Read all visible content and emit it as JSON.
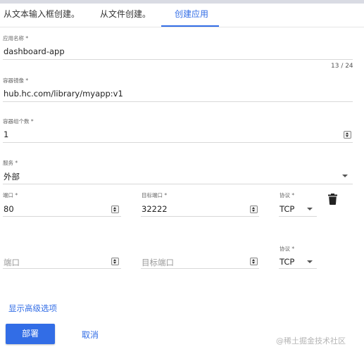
{
  "tabs": [
    {
      "label": "从文本输入框创建。"
    },
    {
      "label": "从文件创建。"
    },
    {
      "label": "创建应用"
    }
  ],
  "form": {
    "app_name": {
      "label": "应用名称 *",
      "value": "dashboard-app",
      "counter": "13 / 24"
    },
    "image": {
      "label": "容器镜像 *",
      "value": "hub.hc.com/library/myapp:v1"
    },
    "pods": {
      "label": "容器组个数 *",
      "value": "1"
    },
    "service": {
      "label": "服务 *",
      "value": "外部"
    },
    "ports": [
      {
        "port_label": "端口 *",
        "port_value": "80",
        "target_label": "目标端口 *",
        "target_value": "32222",
        "protocol_label": "协议 *",
        "protocol_value": "TCP"
      },
      {
        "port_placeholder": "端口",
        "target_placeholder": "目标端口",
        "protocol_label": "协议 *",
        "protocol_value": "TCP"
      }
    ]
  },
  "actions": {
    "advanced_link": "显示高级选项",
    "deploy": "部署",
    "cancel": "取消"
  },
  "watermark": "@稀土掘金技术社区",
  "colors": {
    "accent": "#326de6"
  },
  "icons": {
    "delete": "trash-icon",
    "spinner": "number-spinner-icon",
    "dropdown": "caret-down-icon"
  }
}
